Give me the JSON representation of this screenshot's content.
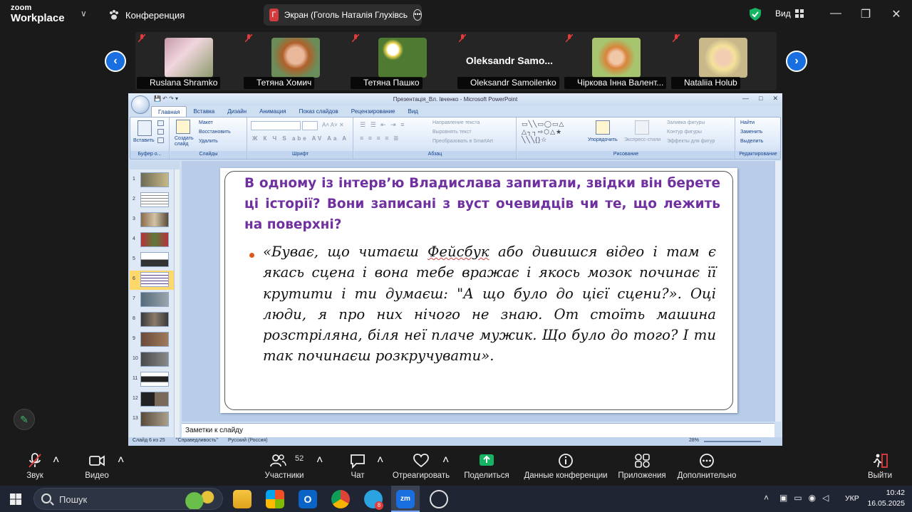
{
  "zoom": {
    "logo_line1": "zoom",
    "logo_line2": "Workplace",
    "meeting_label": "Конференция",
    "share_badge": "Г",
    "share_label": "Экран (Гоголь Наталія Глухівсь",
    "view_label": "Вид"
  },
  "gallery": {
    "tiles": [
      {
        "name": "Ruslana Shramko",
        "muted": true
      },
      {
        "name": "Тетяна Хомич",
        "muted": true
      },
      {
        "name": "Тетяна Пашко",
        "muted": true
      },
      {
        "name": "Oleksandr Samoilenko",
        "big_name": "Oleksandr  Samo...",
        "muted": true
      },
      {
        "name": "Чіркова Інна Валент...",
        "muted": true
      },
      {
        "name": "Nataliia Holub",
        "muted": true
      }
    ]
  },
  "ppt": {
    "window_title": "Презентація_Вл. Івченко - Microsoft PowerPoint",
    "tabs": [
      "Главная",
      "Вставка",
      "Дизайн",
      "Анимация",
      "Показ слайдов",
      "Рецензирование",
      "Вид"
    ],
    "ribbon": {
      "paste": "Вставить",
      "clipboard_group": "Буфер о...",
      "create_slide": "Создать слайд",
      "layout": "Макет",
      "restore": "Восстановить",
      "delete": "Удалить",
      "slides_group": "Слайды",
      "font_group": "Шрифт",
      "text_direction": "Направление текста",
      "align_text": "Выровнять текст",
      "smartart": "Преобразовать в SmartArt",
      "paragraph_group": "Абзац",
      "arrange": "Упорядочить",
      "quick_styles": "Экспресс-стили",
      "shape_fill": "Заливка фигуры",
      "shape_outline": "Контур фигуры",
      "shape_effects": "Эффекты для фигур",
      "drawing_group": "Рисование",
      "find": "Найти",
      "replace": "Заменить",
      "select": "Выделить",
      "editing_group": "Редактирование"
    },
    "thumbnails": [
      "1",
      "2",
      "3",
      "4",
      "5",
      "6",
      "7",
      "8",
      "9",
      "10",
      "11",
      "12",
      "13"
    ],
    "selected_slide": 6,
    "slide": {
      "heading": "В одному із інтерв’ю Владислава запитали, звідки він берете ці історії? Вони записані з вуст очевидців чи те, що лежить на поверхні?",
      "body_before": "«Буває, що читаєш ",
      "body_flagged": "Фейсбук",
      "body_after": " або дивишся відео і там є якась сцена і вона тебе вражає і якось мозок починає її крутити і ти думаєш: \"А що було до цієї сцени?». Оці люди, я про них нічого не знаю. От стоїть машина розстріляна, біля неї плаче мужик. Що було до того? І ти так починаєш розкручувати»."
    },
    "notes_placeholder": "Заметки к слайду",
    "status": {
      "slide_of": "Слайд 6 из 25",
      "theme": "\"Справедливость\"",
      "language": "Русский (Россия)",
      "zoom": "28%"
    }
  },
  "toolbar": {
    "audio": "Звук",
    "video": "Видео",
    "participants": "Участники",
    "participants_count": "52",
    "chat": "Чат",
    "react": "Отреагировать",
    "share": "Поделиться",
    "meeting_info": "Данные конференции",
    "apps": "Приложения",
    "more": "Дополнительно",
    "leave": "Выйти"
  },
  "taskbar": {
    "search_placeholder": "Пошук",
    "language": "УКР",
    "time": "10:42",
    "date": "16.05.2025",
    "telegram_badge": "8"
  },
  "colors": {
    "accent_blue": "#1a6fe0",
    "share_green": "#16b364",
    "slide_heading": "#7030a0",
    "bullet": "#e0571e"
  }
}
